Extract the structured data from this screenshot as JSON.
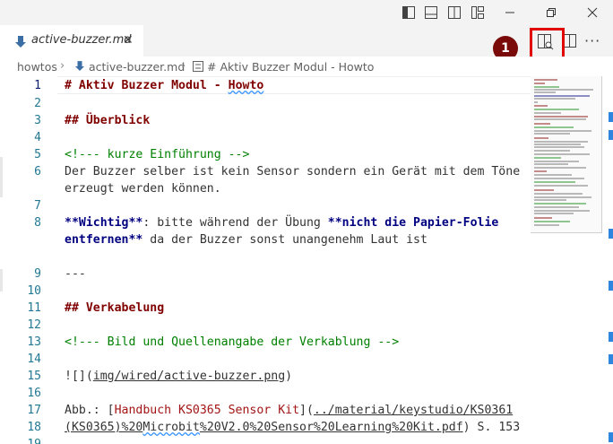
{
  "titlebar": {
    "icons": [
      "toggle-primary-sidebar-icon",
      "toggle-panel-icon",
      "toggle-secondary-sidebar-icon",
      "customize-layout-icon"
    ],
    "window_controls": [
      "minimize-icon",
      "restore-icon",
      "close-icon"
    ]
  },
  "tab": {
    "label": "active-buzzer.md",
    "close_glyph": "✕",
    "icon": "markdown-file-icon"
  },
  "annotation": {
    "badge_number": "1",
    "highlight_color": "#e00000",
    "badge_color": "#7a0a0a"
  },
  "editor_actions": {
    "more_glyph": "···",
    "icons": [
      "open-preview-to-side-icon",
      "split-editor-icon",
      "more-actions-icon"
    ]
  },
  "breadcrumb": {
    "folder": "howtos",
    "file": "active-buzzer.md",
    "symbol_icon": "heading-symbol-icon",
    "symbol": "# Aktiv Buzzer Modul - Howto"
  },
  "editor": {
    "lines": [
      {
        "n": "1"
      },
      {
        "n": "2"
      },
      {
        "n": "3"
      },
      {
        "n": "4"
      },
      {
        "n": "5"
      },
      {
        "n": "6"
      },
      {
        "n": "7"
      },
      {
        "n": "8"
      },
      {
        "n": "9"
      },
      {
        "n": "10"
      },
      {
        "n": "11"
      },
      {
        "n": "12"
      },
      {
        "n": "13"
      },
      {
        "n": "14"
      },
      {
        "n": "15"
      },
      {
        "n": "16"
      },
      {
        "n": "17"
      },
      {
        "n": "18"
      },
      {
        "n": "19"
      }
    ],
    "code": {
      "l1a": "# Aktiv Buzzer Modul - ",
      "l1b": "Howto",
      "l3": "## Überblick",
      "l5": "<!--- kurze Einführung -->",
      "l6a": "Der Buzzer selber ist kein Sensor sondern ein Gerät mit dem Töne",
      "l6b": "erzeugt werden können.",
      "l8a_bold": "**Wichtig**",
      "l8a_text": ": bitte während der Übung ",
      "l8a_bold2": "**nicht die Papier-Folie",
      "l8b_bold": "entfernen**",
      "l8b_text": " da der Buzzer sonst unangenehm Laut ist",
      "l10": "---",
      "l12": "## Verkabelung",
      "l14": "<!--- Bild und Quellenangabe der Verkablung -->",
      "l16a": "![](",
      "l16b": "img/wired/active-buzzer.png",
      "l16c": ")",
      "l18a": "Abb.: [",
      "l18b": "Handbuch KS0365 Sensor Kit",
      "l18c": "](",
      "l18d": "../material/keystudio/KS0361",
      "l18e": "(KS0365)%20",
      "l18f": "Microbit",
      "l18g": "%20V2.0%20Sensor%20Learning%20Kit.pdf",
      "l18h": ") S. 153"
    }
  }
}
